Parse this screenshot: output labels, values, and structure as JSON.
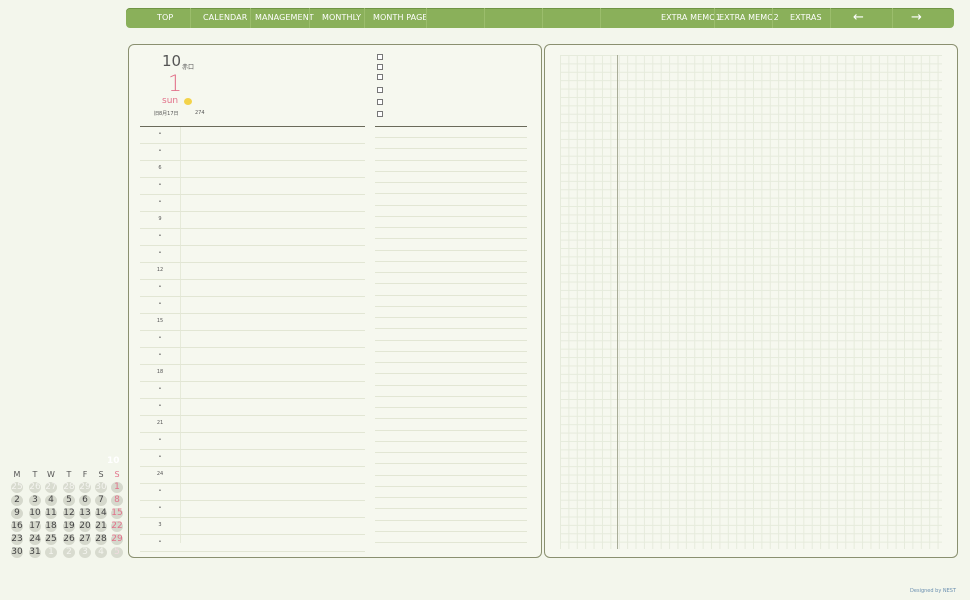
{
  "nav": {
    "items": [
      "TOP",
      "CALENDAR",
      "MANAGEMENT",
      "MONTHLY",
      "MONTH PAGE",
      "EXTRA MEMO1",
      "EXTRA MEMO2",
      "EXTRAS"
    ],
    "prev_arrow": "←",
    "next_arrow": "→"
  },
  "day": {
    "month": "10",
    "month_kanji": "赤口",
    "date": "1",
    "weekday": "sun",
    "lunar": "旧8月17日",
    "day_of_year": "274",
    "weather_icon": "sun-icon"
  },
  "schedule": {
    "hours": [
      "•",
      "•",
      "6",
      "•",
      "•",
      "9",
      "•",
      "•",
      "12",
      "•",
      "•",
      "15",
      "•",
      "•",
      "18",
      "•",
      "•",
      "21",
      "•",
      "•",
      "24",
      "•",
      "•",
      "3",
      "•"
    ]
  },
  "mini_calendar": {
    "month": "10",
    "weekdays": [
      "M",
      "T",
      "W",
      "T",
      "F",
      "S",
      "S"
    ],
    "weeks": [
      [
        "25",
        "26",
        "27",
        "28",
        "29",
        "30",
        "1"
      ],
      [
        "2",
        "3",
        "4",
        "5",
        "6",
        "7",
        "8"
      ],
      [
        "9",
        "10",
        "11",
        "12",
        "13",
        "14",
        "15"
      ],
      [
        "16",
        "17",
        "18",
        "19",
        "20",
        "21",
        "22"
      ],
      [
        "23",
        "24",
        "25",
        "26",
        "27",
        "28",
        "29"
      ],
      [
        "30",
        "31",
        "1",
        "2",
        "3",
        "4",
        "5"
      ]
    ]
  },
  "footer": "Designed by NEST",
  "colors": {
    "nav_bg": "#8ab05a",
    "accent_pink": "#e2728a",
    "page_bg": "#f3f6ec"
  }
}
